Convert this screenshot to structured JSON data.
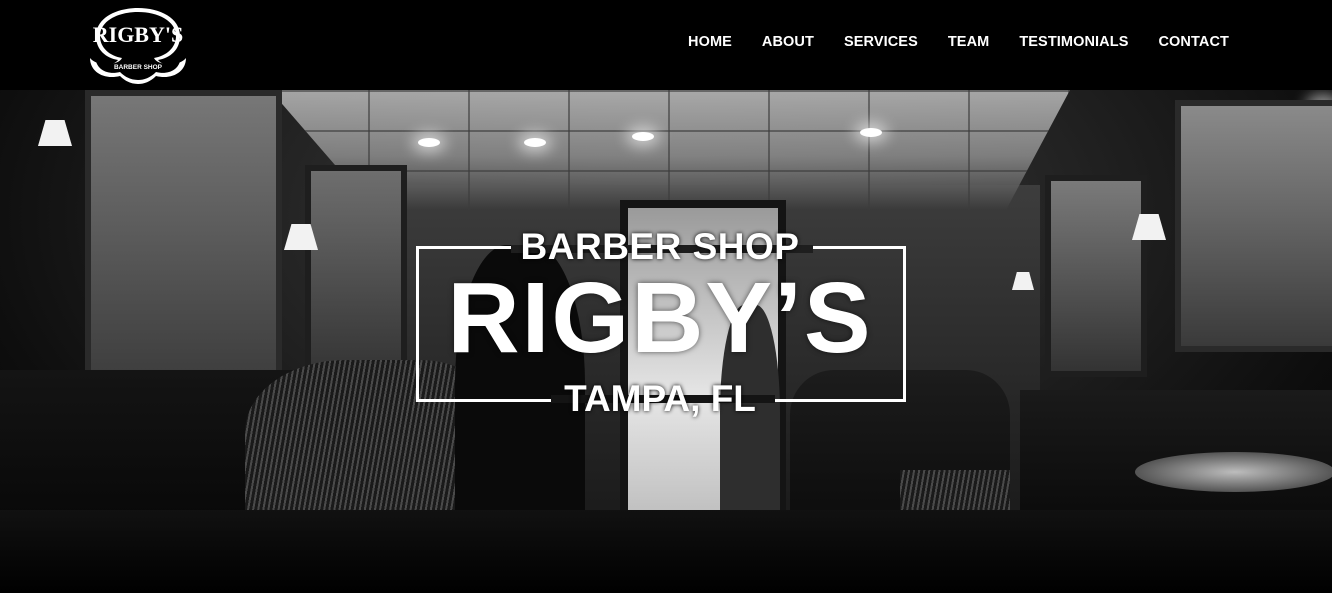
{
  "brand": {
    "logo_text": "RIGBY'S",
    "logo_subtext": "BARBER SHOP"
  },
  "nav": {
    "items": [
      {
        "label": "HOME"
      },
      {
        "label": "ABOUT"
      },
      {
        "label": "SERVICES"
      },
      {
        "label": "TEAM"
      },
      {
        "label": "TESTIMONIALS"
      },
      {
        "label": "CONTACT"
      }
    ]
  },
  "hero": {
    "top_line": "BARBER SHOP",
    "title": "RIGBY’S",
    "bottom_line": "TAMPA, FL"
  },
  "colors": {
    "header_bg": "#000000",
    "nav_text": "#ffffff",
    "emblem": "#ffffff"
  }
}
